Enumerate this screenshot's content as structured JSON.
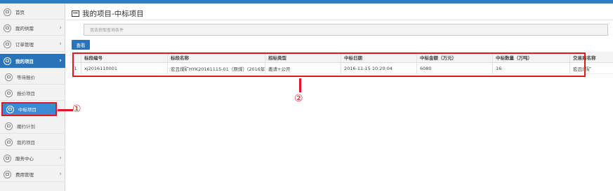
{
  "brand_color": "#2a73b8",
  "highlight_color": "#e0181f",
  "sidebar": {
    "items": [
      {
        "label": "首页",
        "icon": "home-icon",
        "has_arrow": false
      },
      {
        "label": "我的供需",
        "icon": "list-icon",
        "has_arrow": true
      },
      {
        "label": "订单管理",
        "icon": "list-icon",
        "has_arrow": true
      },
      {
        "label": "我的项目",
        "icon": "list-icon",
        "has_arrow": true,
        "active": true
      },
      {
        "label": "等待报价",
        "icon": "document-icon",
        "sub": true
      },
      {
        "label": "报价项目",
        "icon": "document-icon",
        "sub": true
      },
      {
        "label": "中标项目",
        "icon": "document-icon",
        "sub": true,
        "current": true
      },
      {
        "label": "履约计划",
        "icon": "document-icon",
        "sub": true
      },
      {
        "label": "我的项目",
        "icon": "document-icon",
        "sub": true
      },
      {
        "label": "服务中心",
        "icon": "list-icon",
        "has_arrow": true
      },
      {
        "label": "费用管理",
        "icon": "list-icon",
        "has_arrow": true
      }
    ],
    "arrow_glyph": "›"
  },
  "main": {
    "title": "我的项目-中标项目",
    "search_placeholder": "双击获取查询条件",
    "query_button": "查看"
  },
  "table": {
    "headers": [
      "",
      "标段编号",
      "标段名称",
      "招标类型",
      "中标日期",
      "中标金额（万元）",
      "中标数量（万吨）",
      "交易商名称"
    ],
    "rows": [
      [
        "1",
        "xj2016110001",
        "宏丑煤矿HYK20161115-01（原煤）(2016年12",
        "邀请+公开",
        "2016-11-15 10:20:04",
        "6080",
        "16",
        "宏丑煤矿"
      ]
    ]
  },
  "annotations": {
    "callout_1": "①",
    "callout_2": "②"
  }
}
